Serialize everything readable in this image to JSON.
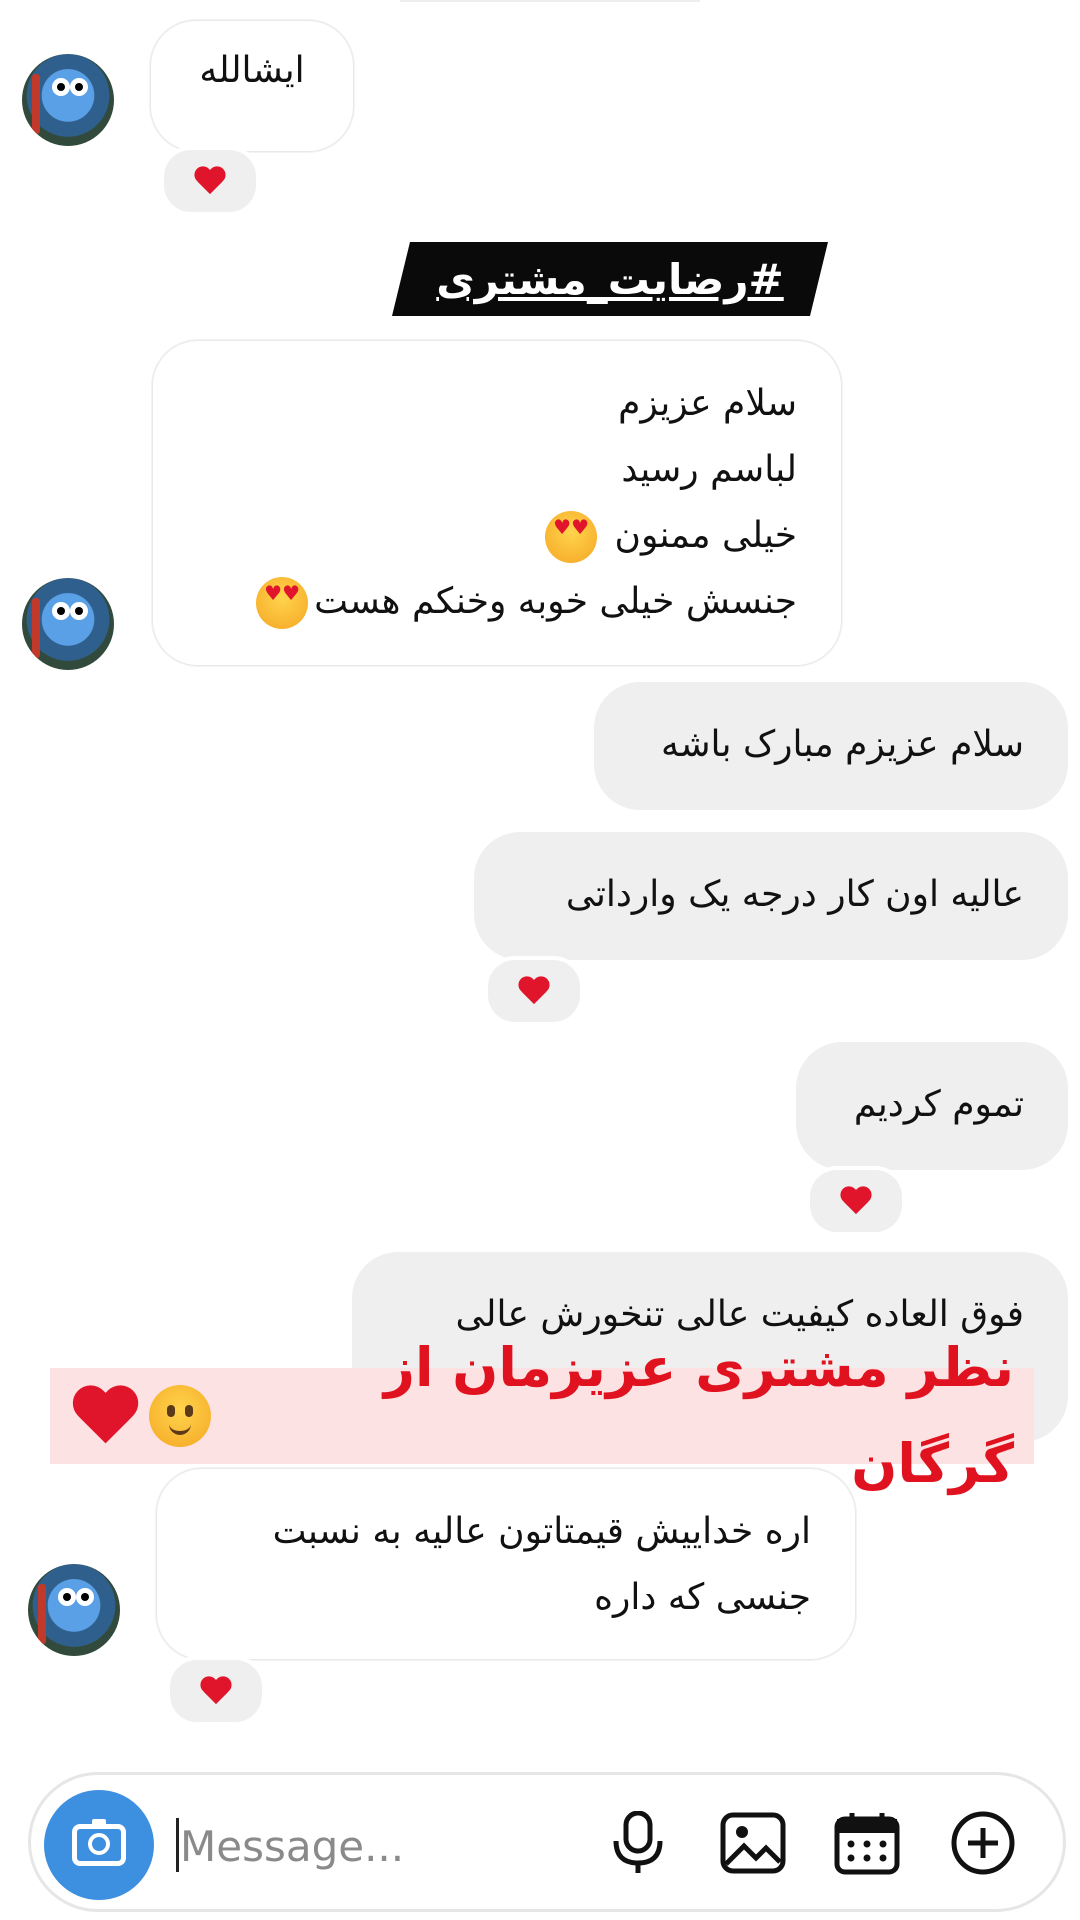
{
  "messages": {
    "m1": {
      "text": "ایشالله"
    },
    "hashtag": "#رضایت_مشتری",
    "m2": {
      "lines": [
        "سلام عزیزم",
        "لباسم رسید",
        "خیلی ممنون",
        "جنسش خیلی خوبه وخنکم هست"
      ]
    },
    "m3": {
      "text": "سلام عزیزم مبارک باشه"
    },
    "m4": {
      "text": "عالیه اون کار درجه یک وارداتی"
    },
    "m5": {
      "text": "تموم کردیم"
    },
    "m6": {
      "text": "فوق العاده کیفیت عالی تنخورش عالی"
    },
    "m7": {
      "lines": [
        "اره خداییش قیمتاتون عالیه به نسبت",
        "جنسی که داره"
      ]
    }
  },
  "overlay": {
    "text": "نظر مشتری عزیزمان از گرگان"
  },
  "reactions": {
    "heart": "heart-icon"
  },
  "composer": {
    "placeholder": "Message..."
  },
  "colors": {
    "accent": "#3d8fe0",
    "heart": "#e0152b",
    "banner_text": "#e0121f",
    "banner_bg": "#fde2e4"
  }
}
